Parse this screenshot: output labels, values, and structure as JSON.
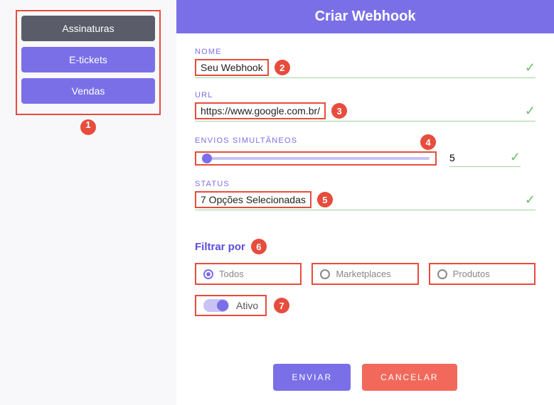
{
  "sidebar": {
    "tabs": [
      {
        "label": "Assinaturas"
      },
      {
        "label": "E-tickets"
      },
      {
        "label": "Vendas"
      }
    ]
  },
  "header": {
    "title": "Criar Webhook"
  },
  "fields": {
    "nome": {
      "label": "NOME",
      "value": "Seu Webhook"
    },
    "url": {
      "label": "URL",
      "value": "https://www.google.com.br/"
    },
    "envios": {
      "label": "ENVIOS SIMULTÂNEOS",
      "value": "5"
    },
    "status": {
      "label": "STATUS",
      "value": "7 Opções Selecionadas"
    }
  },
  "filter": {
    "heading": "Filtrar por",
    "options": [
      {
        "label": "Todos",
        "selected": true
      },
      {
        "label": "Marketplaces",
        "selected": false
      },
      {
        "label": "Produtos",
        "selected": false
      }
    ],
    "toggle": {
      "label": "Ativo",
      "on": true
    }
  },
  "buttons": {
    "submit": "ENVIAR",
    "cancel": "CANCELAR"
  },
  "annotations": {
    "a1": "1",
    "a2": "2",
    "a3": "3",
    "a4": "4",
    "a5": "5",
    "a6": "6",
    "a7": "7"
  }
}
